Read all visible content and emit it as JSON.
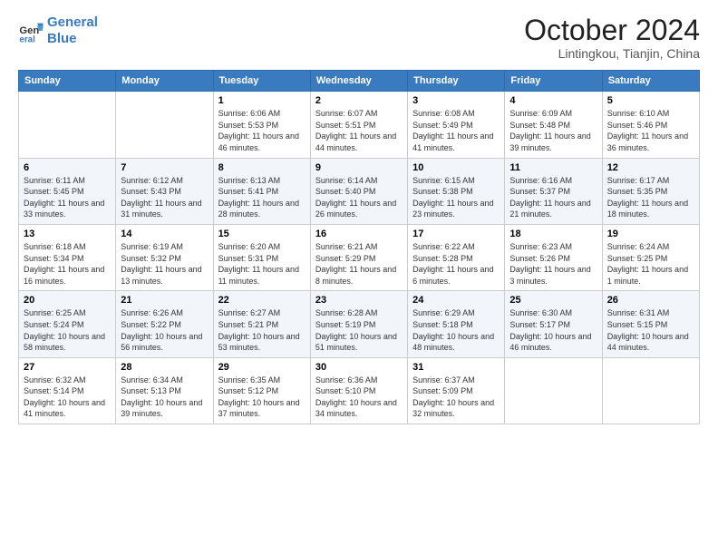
{
  "header": {
    "logo_line1": "General",
    "logo_line2": "Blue",
    "month": "October 2024",
    "location": "Lintingkou, Tianjin, China"
  },
  "weekdays": [
    "Sunday",
    "Monday",
    "Tuesday",
    "Wednesday",
    "Thursday",
    "Friday",
    "Saturday"
  ],
  "weeks": [
    [
      {
        "day": "",
        "detail": ""
      },
      {
        "day": "",
        "detail": ""
      },
      {
        "day": "1",
        "detail": "Sunrise: 6:06 AM\nSunset: 5:53 PM\nDaylight: 11 hours and 46 minutes."
      },
      {
        "day": "2",
        "detail": "Sunrise: 6:07 AM\nSunset: 5:51 PM\nDaylight: 11 hours and 44 minutes."
      },
      {
        "day": "3",
        "detail": "Sunrise: 6:08 AM\nSunset: 5:49 PM\nDaylight: 11 hours and 41 minutes."
      },
      {
        "day": "4",
        "detail": "Sunrise: 6:09 AM\nSunset: 5:48 PM\nDaylight: 11 hours and 39 minutes."
      },
      {
        "day": "5",
        "detail": "Sunrise: 6:10 AM\nSunset: 5:46 PM\nDaylight: 11 hours and 36 minutes."
      }
    ],
    [
      {
        "day": "6",
        "detail": "Sunrise: 6:11 AM\nSunset: 5:45 PM\nDaylight: 11 hours and 33 minutes."
      },
      {
        "day": "7",
        "detail": "Sunrise: 6:12 AM\nSunset: 5:43 PM\nDaylight: 11 hours and 31 minutes."
      },
      {
        "day": "8",
        "detail": "Sunrise: 6:13 AM\nSunset: 5:41 PM\nDaylight: 11 hours and 28 minutes."
      },
      {
        "day": "9",
        "detail": "Sunrise: 6:14 AM\nSunset: 5:40 PM\nDaylight: 11 hours and 26 minutes."
      },
      {
        "day": "10",
        "detail": "Sunrise: 6:15 AM\nSunset: 5:38 PM\nDaylight: 11 hours and 23 minutes."
      },
      {
        "day": "11",
        "detail": "Sunrise: 6:16 AM\nSunset: 5:37 PM\nDaylight: 11 hours and 21 minutes."
      },
      {
        "day": "12",
        "detail": "Sunrise: 6:17 AM\nSunset: 5:35 PM\nDaylight: 11 hours and 18 minutes."
      }
    ],
    [
      {
        "day": "13",
        "detail": "Sunrise: 6:18 AM\nSunset: 5:34 PM\nDaylight: 11 hours and 16 minutes."
      },
      {
        "day": "14",
        "detail": "Sunrise: 6:19 AM\nSunset: 5:32 PM\nDaylight: 11 hours and 13 minutes."
      },
      {
        "day": "15",
        "detail": "Sunrise: 6:20 AM\nSunset: 5:31 PM\nDaylight: 11 hours and 11 minutes."
      },
      {
        "day": "16",
        "detail": "Sunrise: 6:21 AM\nSunset: 5:29 PM\nDaylight: 11 hours and 8 minutes."
      },
      {
        "day": "17",
        "detail": "Sunrise: 6:22 AM\nSunset: 5:28 PM\nDaylight: 11 hours and 6 minutes."
      },
      {
        "day": "18",
        "detail": "Sunrise: 6:23 AM\nSunset: 5:26 PM\nDaylight: 11 hours and 3 minutes."
      },
      {
        "day": "19",
        "detail": "Sunrise: 6:24 AM\nSunset: 5:25 PM\nDaylight: 11 hours and 1 minute."
      }
    ],
    [
      {
        "day": "20",
        "detail": "Sunrise: 6:25 AM\nSunset: 5:24 PM\nDaylight: 10 hours and 58 minutes."
      },
      {
        "day": "21",
        "detail": "Sunrise: 6:26 AM\nSunset: 5:22 PM\nDaylight: 10 hours and 56 minutes."
      },
      {
        "day": "22",
        "detail": "Sunrise: 6:27 AM\nSunset: 5:21 PM\nDaylight: 10 hours and 53 minutes."
      },
      {
        "day": "23",
        "detail": "Sunrise: 6:28 AM\nSunset: 5:19 PM\nDaylight: 10 hours and 51 minutes."
      },
      {
        "day": "24",
        "detail": "Sunrise: 6:29 AM\nSunset: 5:18 PM\nDaylight: 10 hours and 48 minutes."
      },
      {
        "day": "25",
        "detail": "Sunrise: 6:30 AM\nSunset: 5:17 PM\nDaylight: 10 hours and 46 minutes."
      },
      {
        "day": "26",
        "detail": "Sunrise: 6:31 AM\nSunset: 5:15 PM\nDaylight: 10 hours and 44 minutes."
      }
    ],
    [
      {
        "day": "27",
        "detail": "Sunrise: 6:32 AM\nSunset: 5:14 PM\nDaylight: 10 hours and 41 minutes."
      },
      {
        "day": "28",
        "detail": "Sunrise: 6:34 AM\nSunset: 5:13 PM\nDaylight: 10 hours and 39 minutes."
      },
      {
        "day": "29",
        "detail": "Sunrise: 6:35 AM\nSunset: 5:12 PM\nDaylight: 10 hours and 37 minutes."
      },
      {
        "day": "30",
        "detail": "Sunrise: 6:36 AM\nSunset: 5:10 PM\nDaylight: 10 hours and 34 minutes."
      },
      {
        "day": "31",
        "detail": "Sunrise: 6:37 AM\nSunset: 5:09 PM\nDaylight: 10 hours and 32 minutes."
      },
      {
        "day": "",
        "detail": ""
      },
      {
        "day": "",
        "detail": ""
      }
    ]
  ]
}
